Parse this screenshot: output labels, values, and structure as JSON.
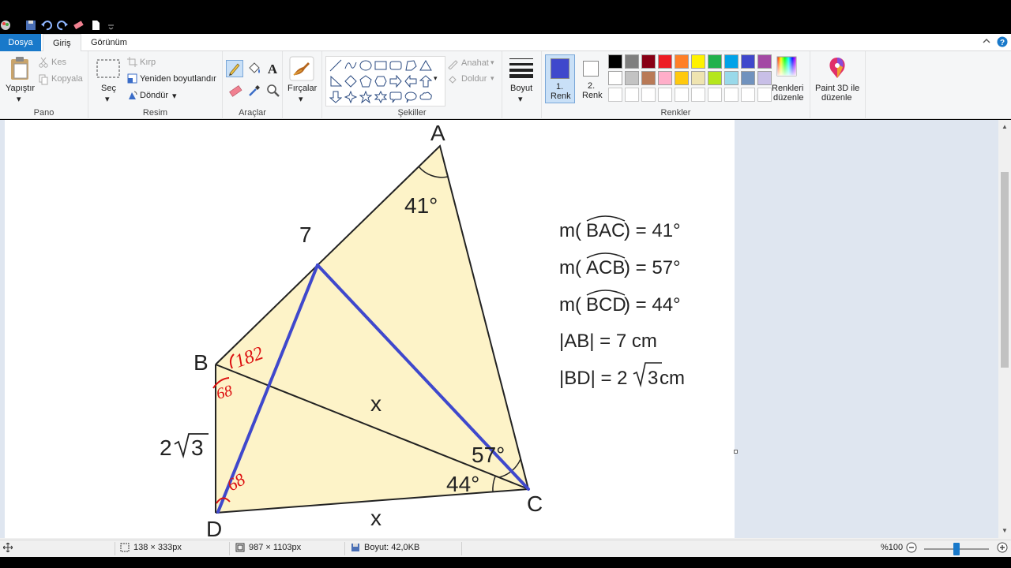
{
  "tabs": {
    "file": "Dosya",
    "home": "Giriş",
    "view": "Görünüm"
  },
  "clipboard": {
    "paste": "Yapıştır",
    "cut": "Kes",
    "copy": "Kopyala",
    "label": "Pano"
  },
  "image": {
    "select": "Seç",
    "crop": "Kırp",
    "resize": "Yeniden boyutlandır",
    "rotate": "Döndür",
    "label": "Resim"
  },
  "tools": {
    "label": "Araçlar"
  },
  "brushes": {
    "label": "Fırçalar"
  },
  "shapes": {
    "outline": "Anahat",
    "fill": "Doldur",
    "label": "Şekiller"
  },
  "size": {
    "label": "Boyut"
  },
  "colors": {
    "color1_line1": "1.",
    "color1_line2": "Renk",
    "color2_line1": "2.",
    "color2_line2": "Renk",
    "edit_line1": "Renkleri",
    "edit_line2": "düzenle",
    "label": "Renkler",
    "color1": "#3f48cc",
    "color2": "#ffffff",
    "row1": [
      "#000000",
      "#7f7f7f",
      "#880015",
      "#ed1c24",
      "#ff7f27",
      "#fff200",
      "#22b14c",
      "#00a2e8",
      "#3f48cc",
      "#a349a4"
    ],
    "row2": [
      "#ffffff",
      "#c3c3c3",
      "#b97a57",
      "#ffaec9",
      "#ffc90e",
      "#efe4b0",
      "#b5e61d",
      "#99d9ea",
      "#7092be",
      "#c8bfe7"
    ]
  },
  "paint3d": {
    "line1": "Paint 3D ile",
    "line2": "düzenle"
  },
  "status": {
    "selection": "138 × 333px",
    "image_size": "987 × 1103px",
    "file_size": "Boyut: 42,0KB",
    "zoom": "%100"
  },
  "figure": {
    "label_A": "A",
    "label_B": "B",
    "label_C": "C",
    "label_D": "D",
    "label_7": "7",
    "angle_A": "41°",
    "angle_C1": "57°",
    "angle_C2": "44°",
    "side_x1": "x",
    "side_x2": "x",
    "side_BD_a": "2",
    "side_BD_b": "3",
    "hand_182": "182",
    "hand_68a": "68",
    "hand_68b": "68"
  },
  "givens": {
    "bac_pre": "m(",
    "bac_arc": "BAC",
    "bac_post": ") = 41°",
    "acb_pre": "m(",
    "acb_arc": "ACB",
    "acb_post": ") = 57°",
    "bcd_pre": "m(",
    "bcd_arc": "BCD",
    "bcd_post": ") = 44°",
    "ab": "|AB| = 7 cm",
    "bd_pre": "|BD| = 2",
    "bd_rad": "3",
    "bd_post": " cm"
  }
}
